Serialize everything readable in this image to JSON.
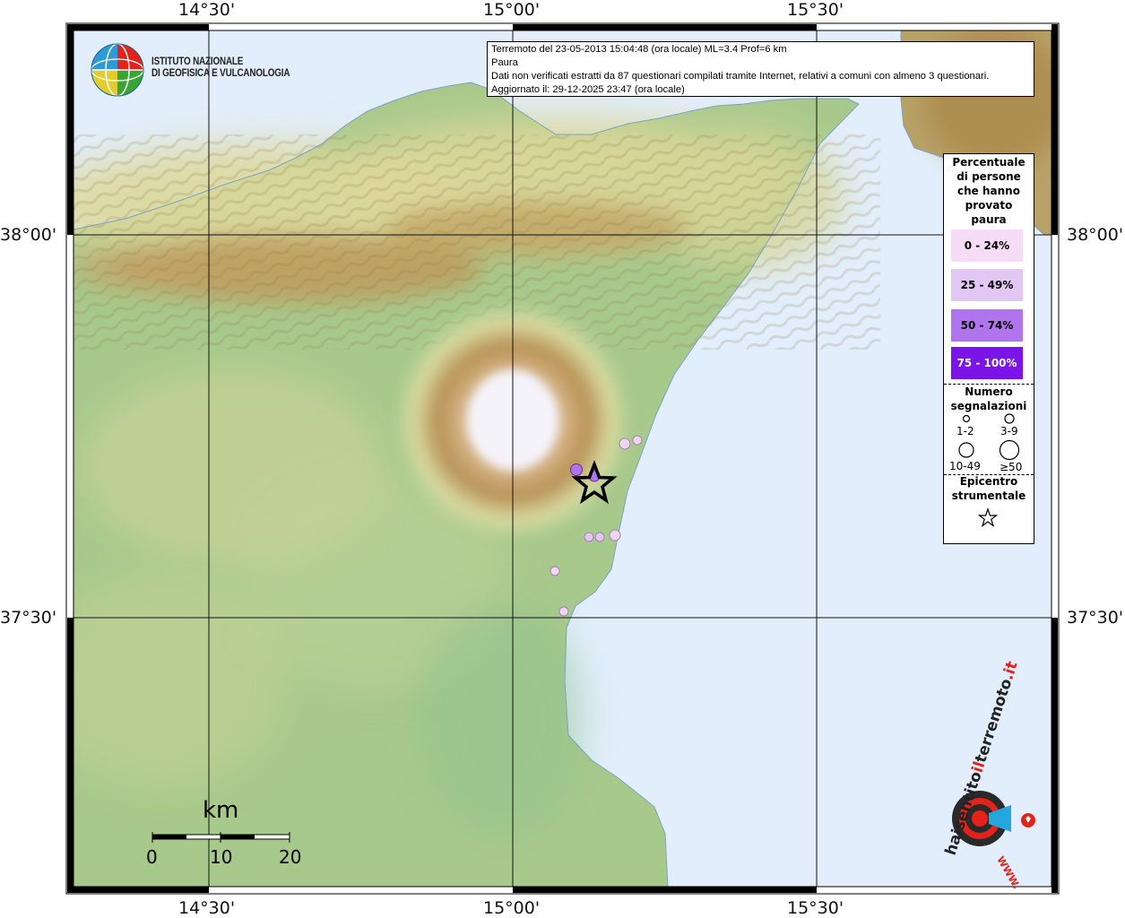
{
  "info": {
    "line1": "Terremoto del 23-05-2013 15:04:48 (ora locale) ML=3.4 Prof=6 km",
    "line2": "Paura",
    "line3": "Dati non verificati estratti da 87 questionari compilati tramite Internet, relativi a comuni con almeno 3 questionari.",
    "line4": "Aggiornato il: 29-12-2025 23:47 (ora locale)"
  },
  "institute": {
    "line1": "ISTITUTO NAZIONALE",
    "line2": "DI GEOFISICA E VULCANOLOGIA"
  },
  "axes": {
    "lon_ticks": [
      "14°30'",
      "15°00'",
      "15°30'"
    ],
    "lat_ticks": [
      "38°00'",
      "37°30'"
    ]
  },
  "legend": {
    "title_lines": [
      "Percentuale",
      "di persone",
      "che hanno",
      "provato",
      "paura"
    ],
    "classes": [
      {
        "label": "0 - 24%",
        "color": "#f7dcf7"
      },
      {
        "label": "25 - 49%",
        "color": "#e2c6f4"
      },
      {
        "label": "50 - 74%",
        "color": "#b074ec"
      },
      {
        "label": "75 - 100%",
        "color": "#7c14ea"
      }
    ],
    "count_title_lines": [
      "Numero",
      "segnalazioni"
    ],
    "count_classes": [
      "1-2",
      "3-9",
      "10-49",
      "≥50"
    ],
    "epicenter_lines": [
      "Epicentro",
      "strumentale"
    ]
  },
  "scale": {
    "unit": "km",
    "ticks": [
      "0",
      "10",
      "20"
    ]
  },
  "watermark": {
    "text": "haisentitoilterremoto.it",
    "url": "www"
  },
  "colors": {
    "sea": "#e2eefb",
    "lowland": "#a7ca8c",
    "hills": "#d8d99c",
    "mountains": "#b48e54",
    "summit": "#f4f2f8",
    "frame": "#000000"
  }
}
